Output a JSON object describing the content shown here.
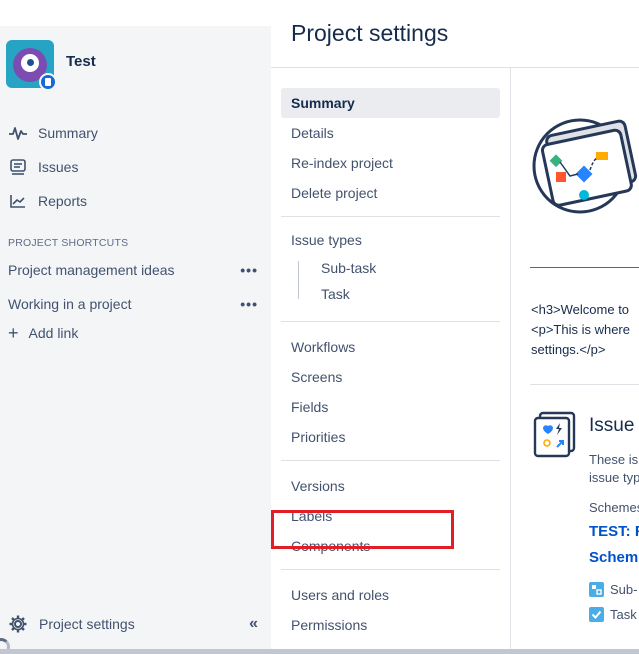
{
  "project": {
    "name": "Test"
  },
  "sidebar": {
    "nav": [
      {
        "label": "Summary",
        "icon": "activity-icon"
      },
      {
        "label": "Issues",
        "icon": "issues-icon"
      },
      {
        "label": "Reports",
        "icon": "reports-icon"
      }
    ],
    "section_title": "PROJECT SHORTCUTS",
    "shortcuts": [
      {
        "label": "Project management ideas",
        "more": "•••"
      },
      {
        "label": "Working in a project",
        "more": "•••"
      }
    ],
    "add_link": {
      "icon": "+",
      "label": "Add link"
    },
    "settings": {
      "label": "Project settings",
      "collapse": "«"
    }
  },
  "page": {
    "title": "Project settings"
  },
  "settings_nav": {
    "group1": [
      "Summary",
      "Details",
      "Re-index project",
      "Delete project"
    ],
    "group2": {
      "title": "Issue types",
      "children": [
        "Sub-task",
        "Task"
      ]
    },
    "group3": [
      "Workflows",
      "Screens",
      "Fields",
      "Priorities"
    ],
    "group4": [
      "Versions",
      "Labels",
      "Components"
    ],
    "group5": [
      "Users and roles",
      "Permissions"
    ],
    "active": "Summary"
  },
  "content": {
    "welcome_line1": "<h3>Welcome to",
    "welcome_line2": "<p>This is where",
    "welcome_line3": "settings.</p>",
    "issue_title": "Issue",
    "issue_desc1": "These is",
    "issue_desc2": "issue typ",
    "schemes_label": "Schemes",
    "scheme_link1": "TEST: F",
    "scheme_link2": "Schem",
    "types": [
      {
        "label": "Sub-",
        "color": "#4bade8"
      },
      {
        "label": "Task",
        "color": "#4bade8"
      }
    ]
  },
  "colors": {
    "highlight": "#e01e26",
    "link": "#0052cc",
    "sidebar_bg": "#f4f5f7"
  }
}
